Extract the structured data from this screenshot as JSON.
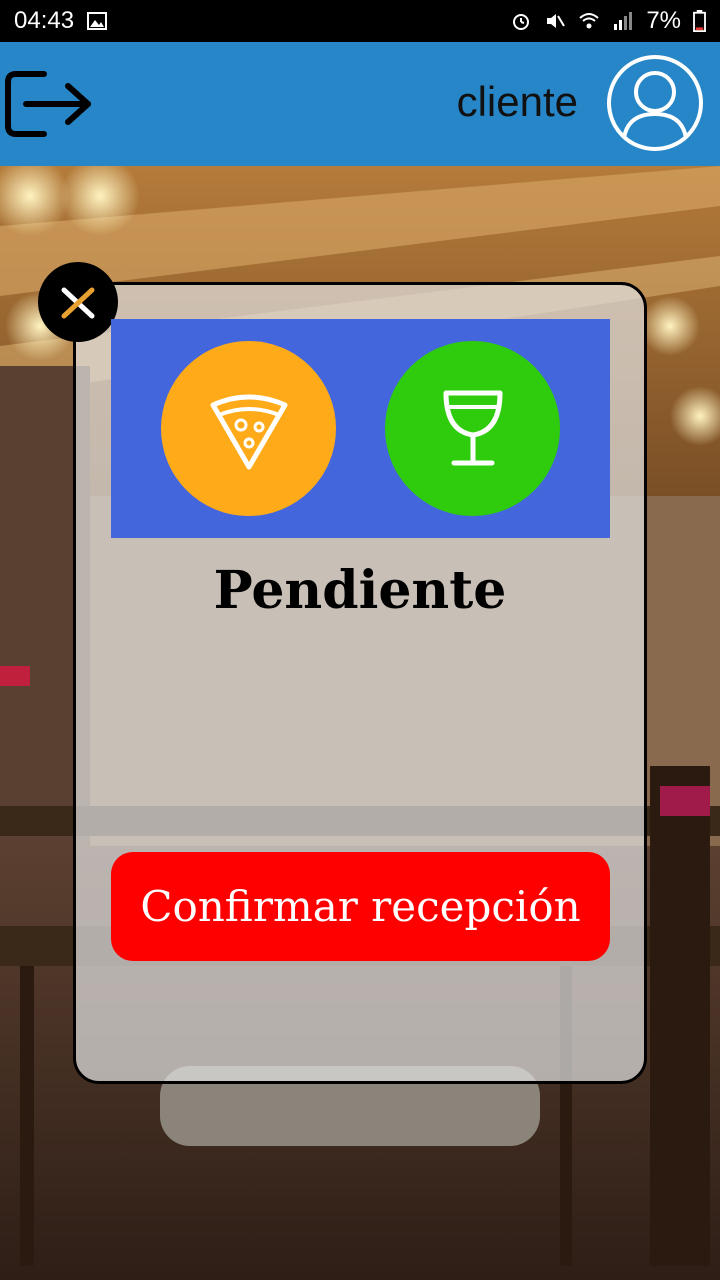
{
  "status_bar": {
    "time": "04:43",
    "battery": "7%",
    "icons": [
      "image-icon",
      "alarm-icon",
      "mute-icon",
      "wifi-icon",
      "signal-icon",
      "battery-icon"
    ]
  },
  "app_bar": {
    "username": "cliente",
    "left_icon": "logout-icon",
    "right_icon": "user-avatar-icon",
    "color": "#2686c8"
  },
  "dialog": {
    "close_icon": "close-icon",
    "categories": [
      {
        "name": "pizza-icon",
        "color": "#ffab19"
      },
      {
        "name": "wine-glass-icon",
        "color": "#2ecc0c"
      }
    ],
    "panel_color": "#4466dd",
    "status": "Pendiente",
    "confirm_label": "Confirmar recepción",
    "confirm_color": "#ff0000"
  }
}
